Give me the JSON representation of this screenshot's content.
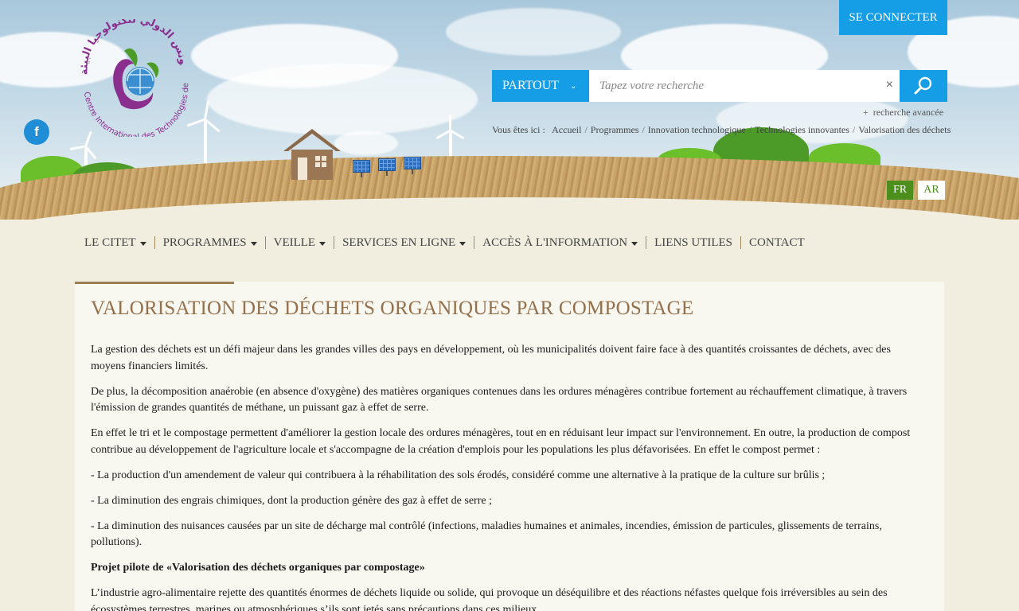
{
  "header": {
    "logo_icon": "citet-logo-icon",
    "logo_arabic": "مركز تونس الدولي لتكنولوجيا البيئة",
    "logo_latin_1": "Centre International",
    "logo_latin_2": "des Technologies de l'Environnement de Tunis",
    "facebook_icon": "f",
    "connect_label": "SE CONNECTER"
  },
  "search": {
    "scope_label": "PARTOUT",
    "placeholder": "Tapez votre recherche",
    "value": "",
    "clear_icon": "×",
    "advanced_plus": "+",
    "advanced_label": "recherche avancée"
  },
  "breadcrumb": {
    "label": "Vous êtes ici :",
    "items": [
      "Accueil",
      "Programmes",
      "Innovation technologique",
      "Technologies innovantes",
      "Valorisation des déchets"
    ],
    "separator": "/"
  },
  "languages": {
    "fr": "FR",
    "ar": "AR",
    "active": "FR"
  },
  "nav": {
    "items": [
      {
        "label": "LE CITET",
        "has_dropdown": true
      },
      {
        "label": "PROGRAMMES",
        "has_dropdown": true
      },
      {
        "label": "VEILLE",
        "has_dropdown": true
      },
      {
        "label": "SERVICES EN LIGNE",
        "has_dropdown": true
      },
      {
        "label": "ACCÈS À L'INFORMATION",
        "has_dropdown": true
      },
      {
        "label": "LIENS UTILES",
        "has_dropdown": false
      },
      {
        "label": "CONTACT",
        "has_dropdown": false
      }
    ]
  },
  "article": {
    "title": "VALORISATION DES DÉCHETS ORGANIQUES PAR COMPOSTAGE",
    "paragraphs": [
      "La gestion des déchets est un défi majeur dans les grandes villes des pays en développement, où les municipalités doivent faire face à des quantités croissantes de déchets, avec des moyens financiers limités.",
      "De plus, la décomposition anaérobie (en absence d'oxygène) des matières organiques contenues dans les ordures ménagères contribue fortement au réchauffement climatique, à travers l'émission de grandes quantités de méthane, un puissant gaz à effet de serre.",
      "En effet le tri et le compostage permettent d'améliorer la gestion locale des ordures ménagères, tout en en réduisant leur impact sur l'environnement. En outre, la production de compost contribue au développement de l'agriculture locale et s'accompagne de la création d'emplois pour les populations les plus défavorisées. En effet le compost permet :",
      "- La production d'un amendement de valeur qui contribuera à la réhabilitation des sols érodés, considéré comme une alternative à la pratique de la culture sur brûlis ;",
      "- La diminution des engrais chimiques, dont la production génère des gaz à effet de serre ;",
      "- La diminution des nuisances causées par un site de décharge mal contrôlé (infections, maladies humaines et animales, incendies, émission de particules, glissements de terrains, pollutions).",
      "Projet pilote de «Valorisation des déchets organiques par compostage»",
      "L’industrie agro-alimentaire rejette des quantités énormes de déchets liquide ou solide, qui provoque un déséquilibre et des réactions néfastes quelque fois irréversibles au sein des écosystèmes terrestres, marines ou atmosphériques s’ils sont jetés sans précautions dans ces milieux."
    ]
  },
  "colors": {
    "accent_blue": "#159de5",
    "lang_green": "#4c8f1c",
    "title_brown": "#94704d",
    "page_beige": "#f1eee0"
  }
}
